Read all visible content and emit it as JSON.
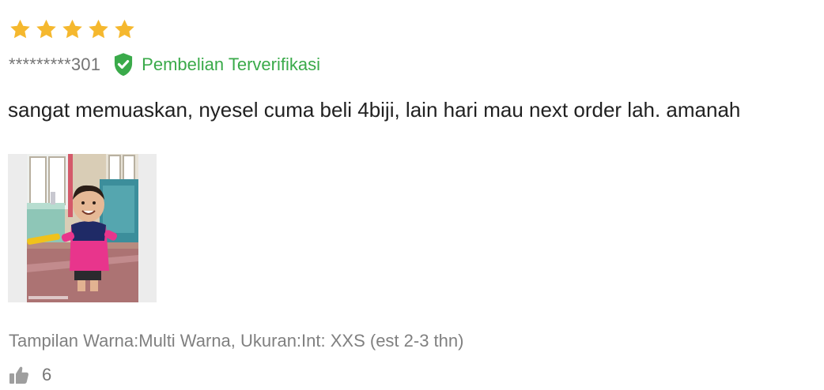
{
  "review": {
    "rating": 5,
    "max_rating": 5,
    "star_color": "#f5b82e",
    "username": "*********301",
    "verified_label": "Pembelian Terverifikasi",
    "verified_color": "#3aaa4a",
    "comment": "sangat memuaskan, nyesel cuma beli 4biji, lain hari mau next order lah. amanah",
    "variant": "Tampilan Warna:Multi Warna, Ukuran:Int: XXS (est 2-3 thn)",
    "likes": "6",
    "icons": {
      "star": "star-icon",
      "verified": "shield-check-icon",
      "like": "thumbs-up-icon"
    }
  }
}
